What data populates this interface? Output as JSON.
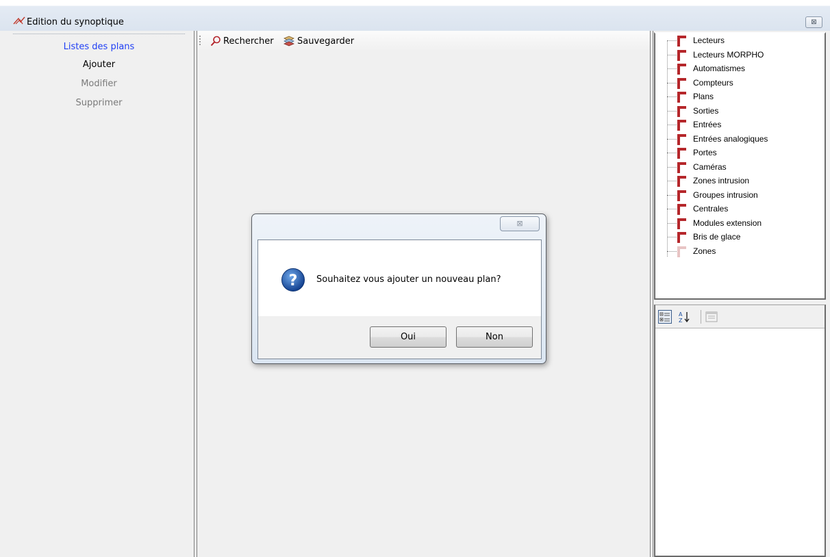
{
  "window": {
    "title": "Edition du synoptique",
    "close_glyph": "⊠"
  },
  "nav": {
    "items": [
      {
        "label": "Listes des plans",
        "state": "active"
      },
      {
        "label": "Ajouter",
        "state": "normal"
      },
      {
        "label": "Modifier",
        "state": "disabled"
      },
      {
        "label": "Supprimer",
        "state": "disabled"
      }
    ]
  },
  "toolbar": {
    "search_label": "Rechercher",
    "save_label": "Sauvegarder"
  },
  "tree": {
    "items": [
      "Lecteurs",
      "Lecteurs MORPHO",
      "Automatismes",
      "Compteurs",
      "Plans",
      "Sorties",
      "Entrées",
      "Entrées analogiques",
      "Portes",
      "Caméras",
      "Zones intrusion",
      "Groupes intrusion",
      "Centrales",
      "Modules extension",
      "Bris de glace",
      "Zones"
    ]
  },
  "dialog": {
    "message": "Souhaitez vous ajouter un nouveau plan?",
    "yes_label": "Oui",
    "no_label": "Non",
    "close_glyph": "⊠"
  },
  "colors": {
    "active_link": "#1f3ff5",
    "disabled_text": "#7a7a7a",
    "tree_icon": "#b5272b"
  }
}
